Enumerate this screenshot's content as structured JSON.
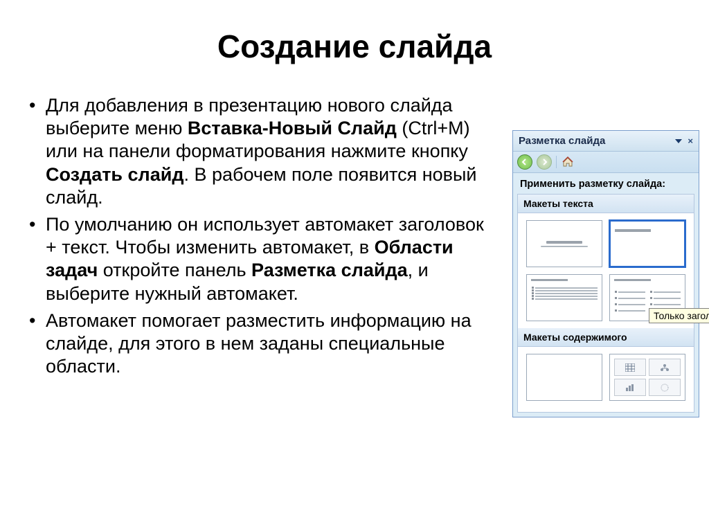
{
  "slide": {
    "title": "Создание слайда",
    "bullets": [
      {
        "pre": "Для добавления в презентацию нового слайда выберите меню ",
        "b1": "Вставка-Новый Слайд",
        "mid1": " (Ctrl+M) или на панели форматирования нажмите кнопку ",
        "b2": "Создать слайд",
        "post": ". В рабочем поле появится новый слайд."
      },
      {
        "pre": "По умолчанию он использует автомакет заголовок + текст. Чтобы изменить автомакет, в ",
        "b1": "Области задач",
        "mid1": " откройте панель ",
        "b2": "Разметка слайда",
        "post": ", и выберите нужный автомакет."
      },
      {
        "pre": "Автомакет помогает разместить информацию на слайде, для этого в нем заданы специальные области.",
        "b1": "",
        "mid1": "",
        "b2": "",
        "post": ""
      }
    ]
  },
  "taskpane": {
    "title": "Разметка слайда",
    "apply_label": "Применить разметку слайда:",
    "section_text": "Макеты текста",
    "section_content": "Макеты содержимого",
    "tooltip": "Только заголо"
  }
}
